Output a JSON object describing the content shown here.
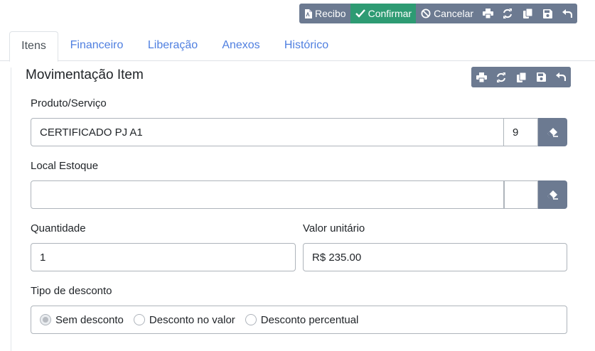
{
  "toolbar": {
    "recibo_label": "Recibo",
    "confirmar_label": "Confirmar",
    "cancelar_label": "Cancelar",
    "icons": [
      "print-icon",
      "refresh-icon",
      "copy-icon",
      "save-icon",
      "undo-icon"
    ]
  },
  "tabs": [
    {
      "label": "Itens",
      "active": true
    },
    {
      "label": "Financeiro",
      "active": false
    },
    {
      "label": "Liberação",
      "active": false
    },
    {
      "label": "Anexos",
      "active": false
    },
    {
      "label": "Histórico",
      "active": false
    }
  ],
  "section": {
    "title": "Movimentação Item",
    "icons": [
      "print-icon",
      "refresh-icon",
      "copy-icon",
      "save-icon",
      "undo-icon"
    ]
  },
  "form": {
    "produto": {
      "label": "Produto/Serviço",
      "value": "CERTIFICADO PJ A1",
      "code": "9"
    },
    "local_estoque": {
      "label": "Local Estoque",
      "value": "",
      "code": ""
    },
    "quantidade": {
      "label": "Quantidade",
      "value": "1"
    },
    "valor_unitario": {
      "label": "Valor unitário",
      "value": "R$ 235.00"
    },
    "tipo_desconto": {
      "label": "Tipo de desconto",
      "options": [
        {
          "label": "Sem desconto",
          "selected": true
        },
        {
          "label": "Desconto no valor",
          "selected": false
        },
        {
          "label": "Desconto percentual",
          "selected": false
        }
      ]
    }
  },
  "colors": {
    "accent_green": "#2e9b73",
    "button_gray": "#6c7a91",
    "tab_link": "#4f7fe0"
  }
}
